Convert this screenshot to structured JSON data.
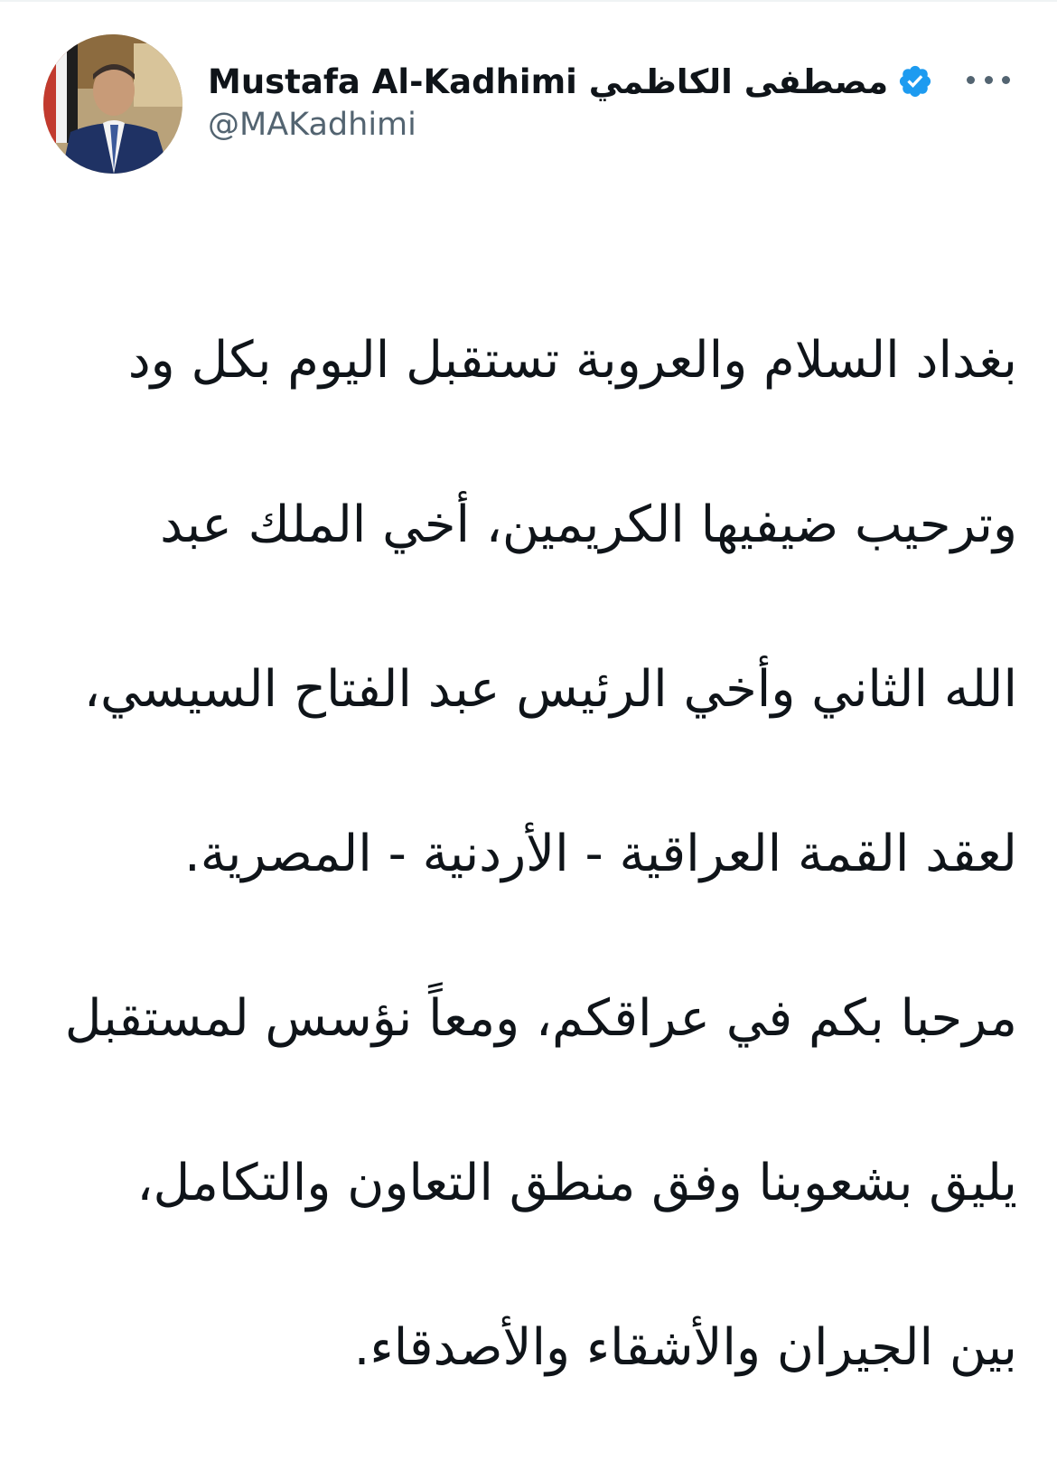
{
  "author": {
    "display_name": "Mustafa Al-Kadhimi مصطفى الكاظمي",
    "handle": "@MAKadhimi",
    "verified_icon": "verified-badge-icon",
    "verified_color": "#1d9bf0"
  },
  "more_menu": {
    "icon": "more-horizontal-icon"
  },
  "tweet": {
    "lines": [
      "بغداد السلام والعروبة تستقبل اليوم بكل ود",
      "وترحيب ضيفيها الكريمين، أخي الملك عبد",
      "الله الثاني وأخي الرئيس عبد الفتاح السيسي،",
      "لعقد القمة العراقية - الأردنية - المصرية.",
      "مرحبا بكم في عراقكم، ومعاً نؤسس لمستقبل",
      "يليق بشعوبنا وفق منطق التعاون والتكامل،",
      "بين الجيران والأشقاء والأصدقاء."
    ]
  },
  "colors": {
    "text": "#0f1419",
    "secondary": "#536471",
    "accent": "#1d9bf0"
  }
}
